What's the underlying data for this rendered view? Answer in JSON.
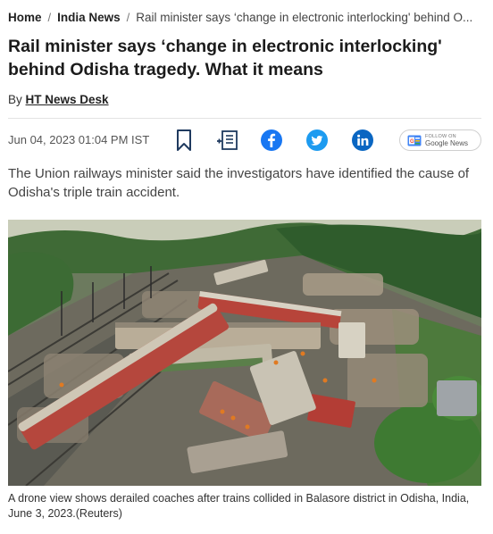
{
  "breadcrumb": {
    "home": "Home",
    "section": "India News",
    "current": "Rail minister says ‘change in electronic interlocking' behind O..."
  },
  "headline": "Rail minister says ‘change in electronic interlocking' behind Odisha tragedy. What it means",
  "byline": {
    "prefix": "By",
    "author": "HT News Desk"
  },
  "meta": {
    "date": "Jun 04, 2023 01:04 PM IST",
    "icons": [
      "bookmark-icon",
      "read-later-icon",
      "facebook-icon",
      "twitter-icon",
      "linkedin-icon"
    ],
    "google_news": {
      "follow_on": "FOLLOW ON",
      "label": "Google News"
    }
  },
  "summary": "The Union railways minister said the investigators have identified the cause of Odisha's triple train accident.",
  "image": {
    "caption": "A drone view shows derailed coaches after trains collided in Balasore district in Odisha, India, June 3, 2023.(Reuters)"
  },
  "colors": {
    "facebook": "#1877f2",
    "twitter": "#1d9bf0",
    "linkedin": "#0a66c2",
    "icon_stroke": "#1f3a5f"
  }
}
